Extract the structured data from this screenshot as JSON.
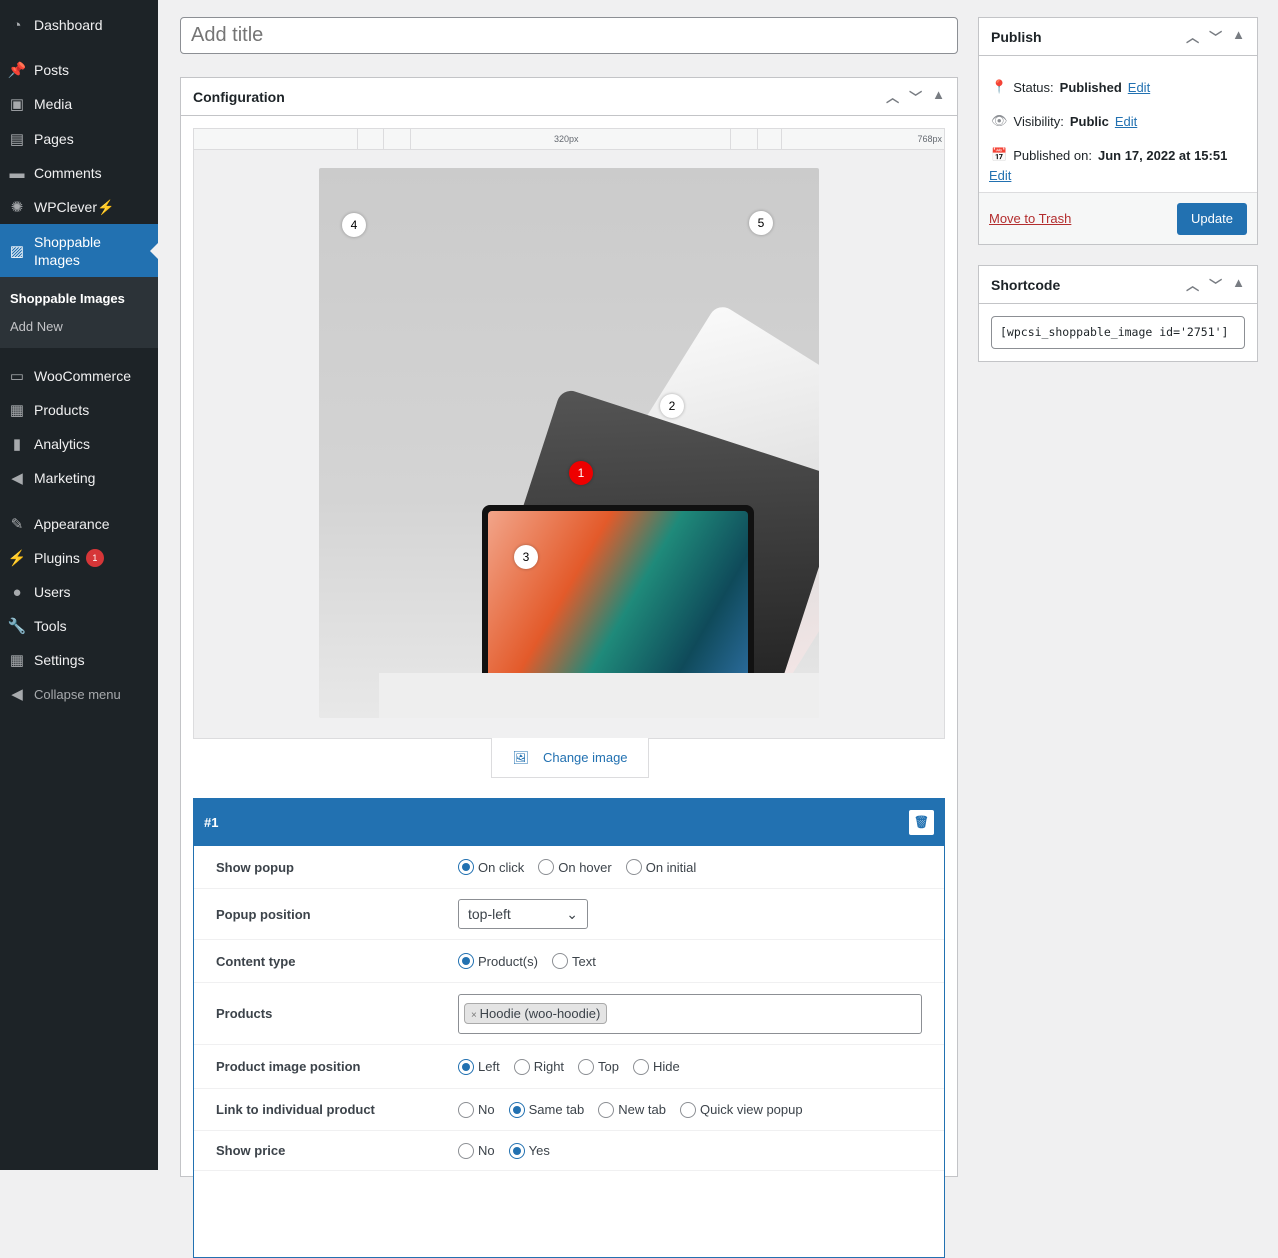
{
  "sidebar": {
    "items": [
      {
        "label": "Dashboard",
        "icon": "dashboard-icon"
      },
      {
        "label": "Posts",
        "icon": "pin-icon"
      },
      {
        "label": "Media",
        "icon": "media-icon"
      },
      {
        "label": "Pages",
        "icon": "pages-icon"
      },
      {
        "label": "Comments",
        "icon": "comment-icon"
      },
      {
        "label": "WPClever⚡",
        "icon": "bulb-icon"
      },
      {
        "label": "Shoppable Images",
        "icon": "image-icon"
      },
      {
        "label": "WooCommerce",
        "icon": "woo-icon"
      },
      {
        "label": "Products",
        "icon": "archive-icon"
      },
      {
        "label": "Analytics",
        "icon": "chart-icon"
      },
      {
        "label": "Marketing",
        "icon": "megaphone-icon"
      },
      {
        "label": "Appearance",
        "icon": "brush-icon"
      },
      {
        "label": "Plugins",
        "icon": "plugin-icon",
        "badge": "1"
      },
      {
        "label": "Users",
        "icon": "user-icon"
      },
      {
        "label": "Tools",
        "icon": "wrench-icon"
      },
      {
        "label": "Settings",
        "icon": "settings-icon"
      },
      {
        "label": "Collapse menu",
        "icon": "collapse-icon"
      }
    ],
    "submenu": [
      "Shoppable Images",
      "Add New"
    ]
  },
  "title_placeholder": "Add title",
  "config": {
    "title": "Configuration",
    "ruler": [
      "320px",
      "768px"
    ],
    "hotspots": [
      "1",
      "2",
      "3",
      "4",
      "5"
    ],
    "change_image": "Change image"
  },
  "hotspot": {
    "title": "#1",
    "rows": [
      {
        "label": "Show popup",
        "options": [
          "On click",
          "On hover",
          "On initial"
        ],
        "selected": 0
      },
      {
        "label": "Popup position",
        "select": "top-left"
      },
      {
        "label": "Content type",
        "options": [
          "Product(s)",
          "Text"
        ],
        "selected": 0
      },
      {
        "label": "Products",
        "tag": "Hoodie (woo-hoodie)"
      },
      {
        "label": "Product image position",
        "options": [
          "Left",
          "Right",
          "Top",
          "Hide"
        ],
        "selected": 0
      },
      {
        "label": "Link to individual product",
        "options": [
          "No",
          "Same tab",
          "New tab",
          "Quick view popup"
        ],
        "selected": 1
      },
      {
        "label": "Show price",
        "options": [
          "No",
          "Yes"
        ],
        "selected": 1
      }
    ]
  },
  "publish": {
    "title": "Publish",
    "status_label": "Status:",
    "status": "Published",
    "visibility_label": "Visibility:",
    "visibility": "Public",
    "published_label": "Published on:",
    "published": "Jun 17, 2022 at 15:51",
    "edit": "Edit",
    "trash": "Move to Trash",
    "update": "Update"
  },
  "shortcode": {
    "title": "Shortcode",
    "value": "[wpcsi_shoppable_image id='2751']"
  }
}
